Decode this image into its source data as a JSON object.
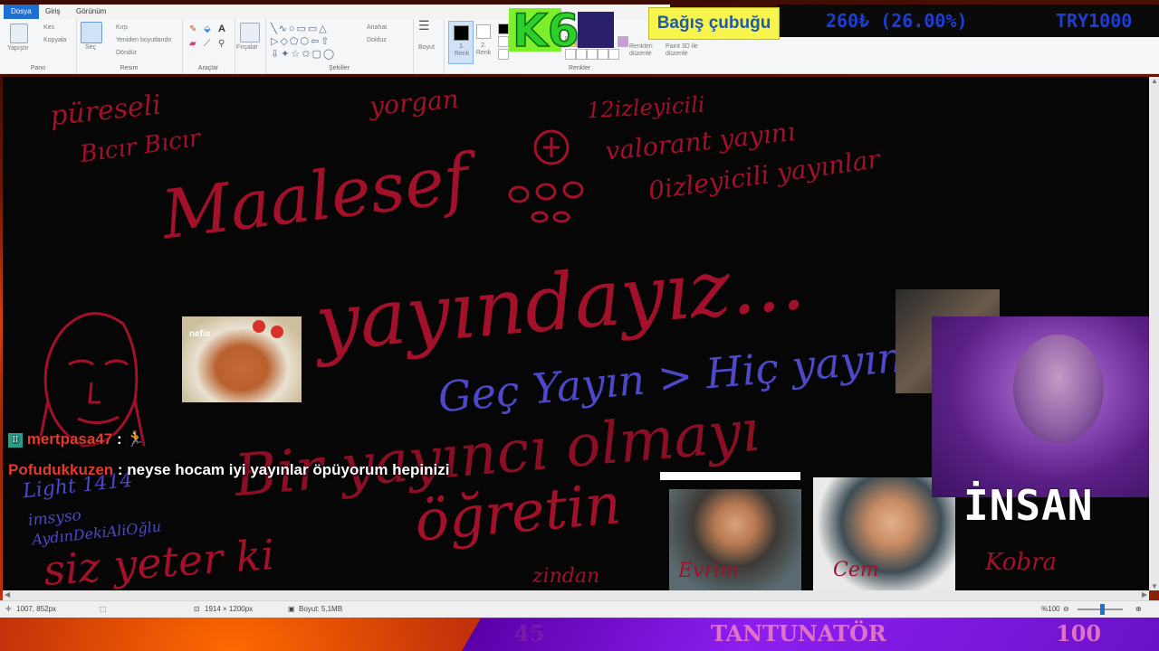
{
  "ribbon": {
    "tabs": [
      "Dosya",
      "Giriş",
      "Görünüm"
    ],
    "clipboard": {
      "paste": "Yapıştır",
      "cut": "Kes",
      "copy": "Kopyala",
      "label": "Pano"
    },
    "image": {
      "select": "Seç",
      "crop": "Kırp",
      "resize": "Yeniden boyutlandır",
      "rotate": "Döndür",
      "label": "Resim"
    },
    "tools": {
      "label": "Araçlar"
    },
    "brushes": {
      "label": "Fırçalar"
    },
    "shapes": {
      "outline": "Anahat",
      "fill": "Dolduz",
      "label": "Şekiller"
    },
    "size": {
      "label": "Boyut"
    },
    "colors": {
      "color1": "1. Renk",
      "color2": "2. Renk",
      "edit": "Renkleri düzenle",
      "paint3d": "Paint 3D ile düzenle",
      "label": "Renkler"
    }
  },
  "overlay": {
    "k6_logo": "K6",
    "donation_label": "Bağış çubuğu",
    "donation_amount": "260₺ (26.00%)",
    "donation_goal": "TRY1000"
  },
  "canvas": {
    "texts": {
      "pureseli": "püreseli",
      "bicir": "Bıcır Bıcır",
      "yorgan": "yorgan",
      "izleyicili12": "12izleyicili",
      "valorant": "valorant yayını",
      "maalesef": "Maalesef",
      "izleyicili0": "0izleyicili yayınlar",
      "yayindayiz": "yayındayız...",
      "gec_yayin": "Geç Yayın > Hiç yayın",
      "bir_yayinci": "Bir yayıncı olmayı",
      "ogretin": "öğretin",
      "siz_yeter": "siz yeter ki",
      "light": "Light 1414",
      "imsyso": "imsyso",
      "aydin": "AydınDekiAliOğlu",
      "evrim": "Evrim",
      "cem": "Cem",
      "kobra": "Kobra",
      "zindan": "zindan"
    },
    "nefis_label": "nefis"
  },
  "chat": [
    {
      "user": "mertpasa47",
      "message": ":"
    },
    {
      "user": "Pofudukkuzen",
      "message": ": neyse hocam iyi yayınlar öpüyorum hepinizi"
    }
  ],
  "webcam_label": "İNSAN",
  "status": {
    "cursor": "1007, 852px",
    "dimensions": "1914 × 1200px",
    "size": "Boyut: 5,1MB",
    "zoom": "%100"
  },
  "bottom_bar": {
    "left_value": "45",
    "title": "TANTUNATÖR",
    "right_value": "100"
  }
}
